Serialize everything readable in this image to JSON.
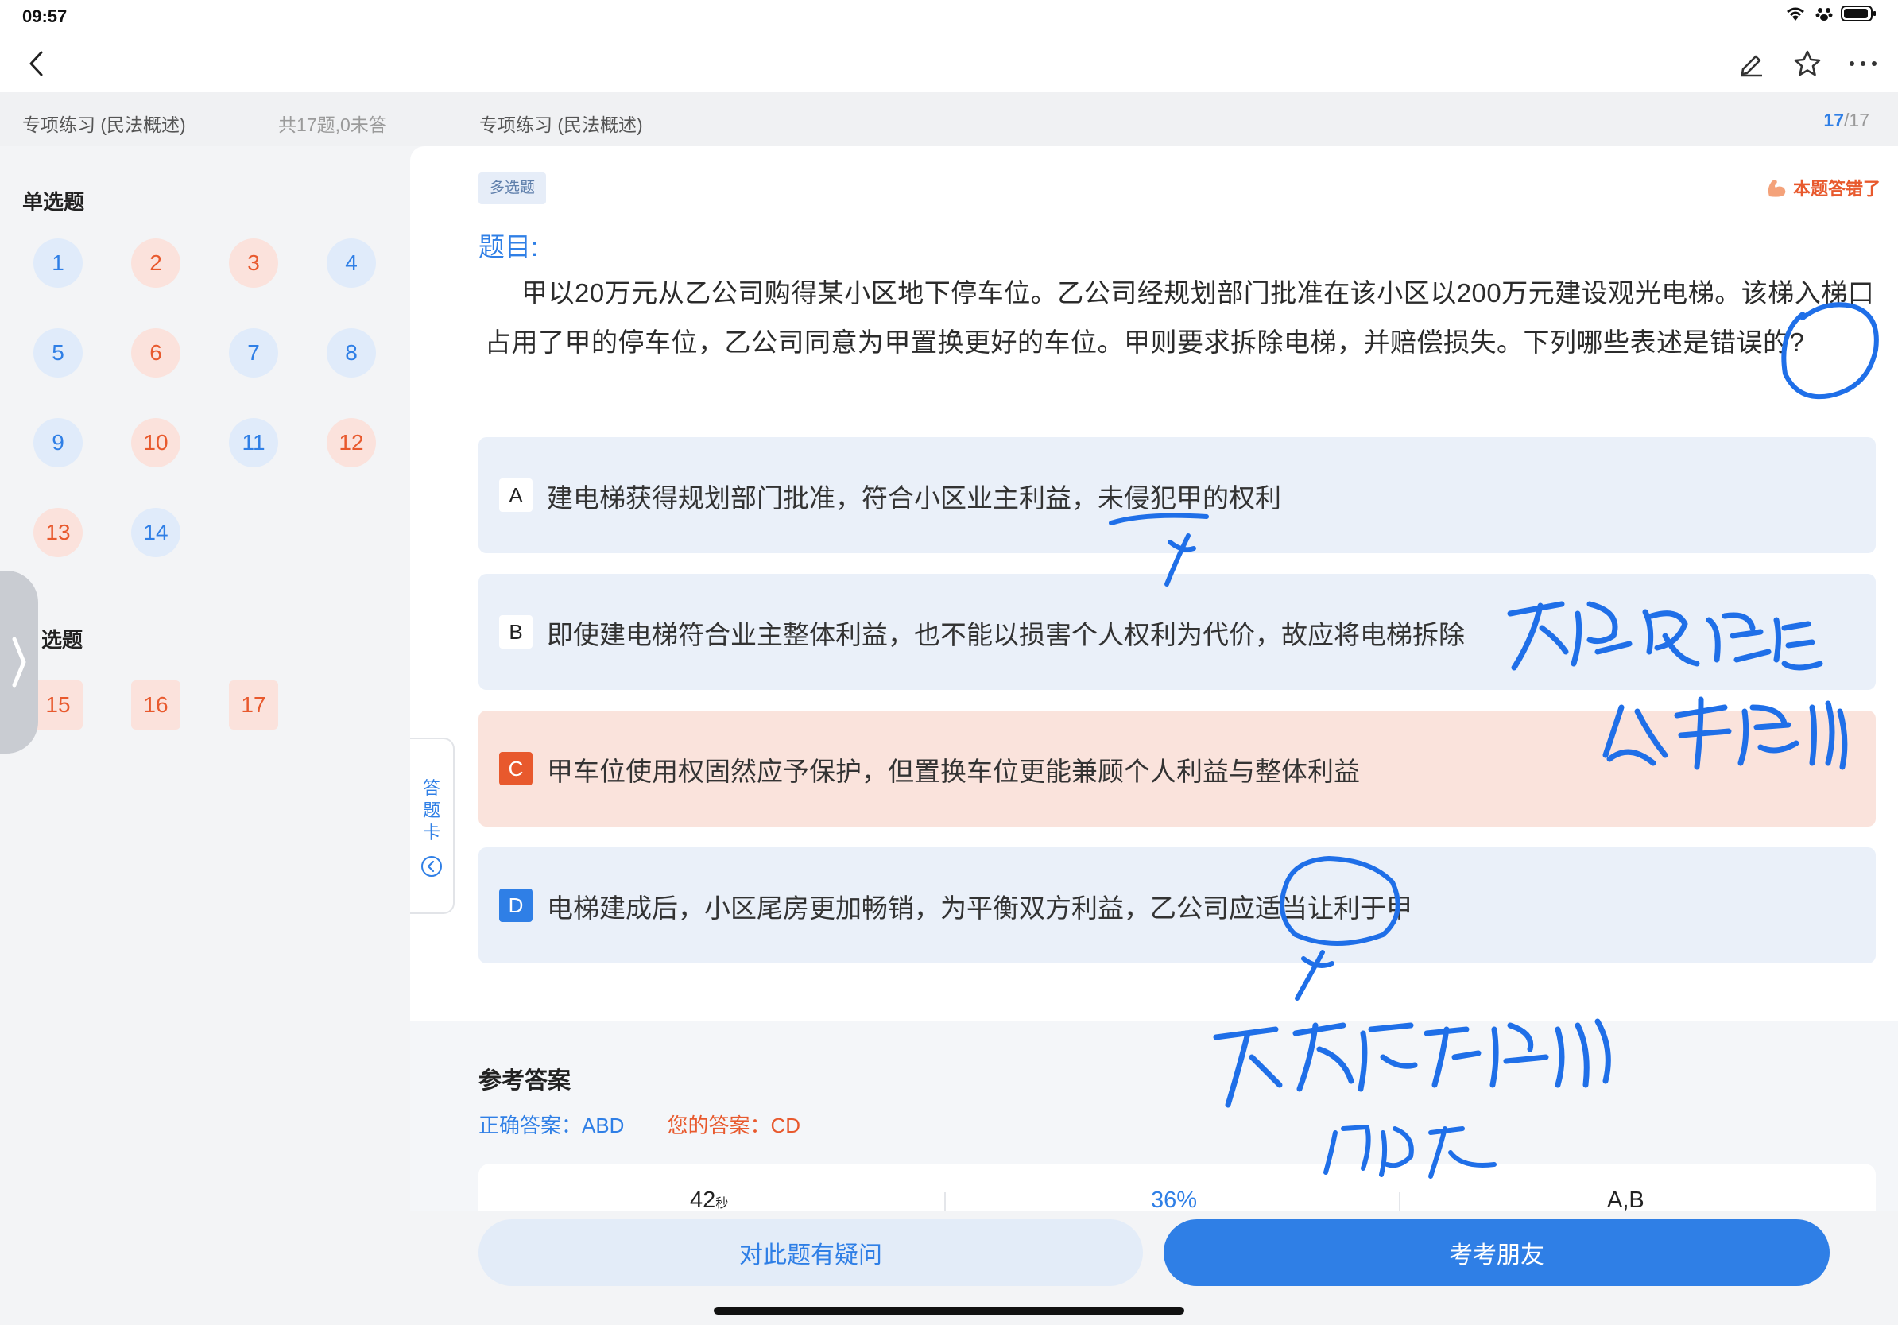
{
  "status_bar": {
    "time": "09:57"
  },
  "nav": {
    "back_icon": "chevron-left-icon",
    "actions": [
      "edit-icon",
      "star-icon",
      "more-icon"
    ]
  },
  "subheader": {
    "left_title": "专项练习 (民法概述)",
    "left_count": "共17题,0未答",
    "right_title": "专项练习 (民法概述)",
    "progress_current": "17",
    "progress_total": "/17"
  },
  "sheet": {
    "single_title": "单选题",
    "multi_title": "选题",
    "single": [
      {
        "n": "1",
        "state": "right"
      },
      {
        "n": "2",
        "state": "wrong"
      },
      {
        "n": "3",
        "state": "wrong"
      },
      {
        "n": "4",
        "state": "right"
      },
      {
        "n": "5",
        "state": "right"
      },
      {
        "n": "6",
        "state": "wrong"
      },
      {
        "n": "7",
        "state": "right"
      },
      {
        "n": "8",
        "state": "right"
      },
      {
        "n": "9",
        "state": "right"
      },
      {
        "n": "10",
        "state": "wrong"
      },
      {
        "n": "11",
        "state": "right"
      },
      {
        "n": "12",
        "state": "wrong"
      },
      {
        "n": "13",
        "state": "wrong"
      },
      {
        "n": "14",
        "state": "right"
      }
    ],
    "multi": [
      {
        "n": "15",
        "state": "wrong"
      },
      {
        "n": "16",
        "state": "wrong"
      },
      {
        "n": "17",
        "state": "wrong"
      }
    ]
  },
  "answer_card_tab": {
    "label": "答题卡"
  },
  "question": {
    "type_tag": "多选题",
    "wrong_flag": "本题答错了",
    "label": "题目:",
    "text": "甲以20万元从乙公司购得某小区地下停车位。乙公司经规划部门批准在该小区以200万元建设观光电梯。该梯入梯口占用了甲的停车位，乙公司同意为甲置换更好的车位。甲则要求拆除电梯，并赔偿损失。下列哪些表述是错误的?",
    "options": [
      {
        "letter": "A",
        "text": "建电梯获得规划部门批准，符合小区业主利益，未侵犯甲的权利"
      },
      {
        "letter": "B",
        "text": "即使建电梯符合业主整体利益，也不能以损害个人权利为代价，故应将电梯拆除"
      },
      {
        "letter": "C",
        "text": "甲车位使用权固然应予保护，但置换车位更能兼顾个人利益与整体利益"
      },
      {
        "letter": "D",
        "text": "电梯建成后，小区尾房更加畅销，为平衡双方利益，乙公司应适当让利于甲"
      }
    ]
  },
  "reference": {
    "title": "参考答案",
    "correct_label": "正确答案：ABD",
    "mine_label": "您的答案：CD",
    "stats": {
      "time": "42",
      "time_unit": "秒",
      "accuracy": "36%",
      "common_wrong": "A,B"
    }
  },
  "buttons": {
    "ask": "对此题有疑问",
    "friend": "考考朋友"
  },
  "colors": {
    "accent": "#2f7fe6",
    "wrong": "#e8592d"
  }
}
